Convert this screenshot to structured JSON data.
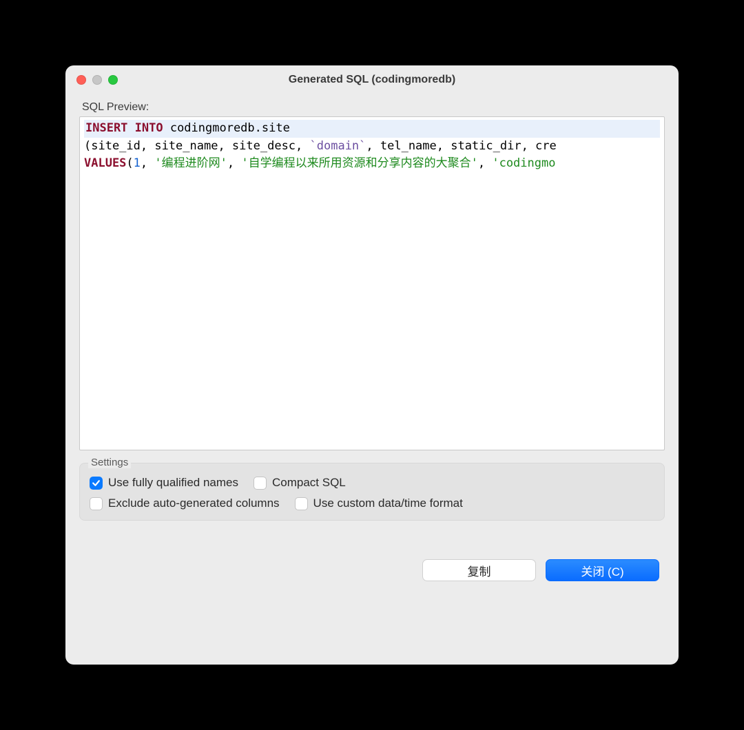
{
  "window": {
    "title": "Generated SQL (codingmoredb)"
  },
  "sections": {
    "preview_label": "SQL Preview:",
    "settings_label": "Settings"
  },
  "sql": {
    "keyword_insert": "INSERT INTO",
    "table": " codingmoredb.site",
    "columns_prefix": "(site_id, site_name, site_desc, ",
    "domain_col": "`domain`",
    "columns_suffix": ", tel_name, static_dir, cre",
    "values_kw": "VALUES",
    "paren": "(",
    "val_num": "1",
    "comma1": ", ",
    "val_str1": "'编程进阶网'",
    "comma2": ", ",
    "val_str2": "'自学编程以来所用资源和分享内容的大聚合'",
    "comma3": ", ",
    "val_str3": "'codingmo"
  },
  "settings": {
    "opt1": {
      "label": "Use fully qualified names",
      "checked": true
    },
    "opt2": {
      "label": "Compact SQL",
      "checked": false
    },
    "opt3": {
      "label": "Exclude auto-generated columns",
      "checked": false
    },
    "opt4": {
      "label": "Use custom data/time format",
      "checked": false
    }
  },
  "buttons": {
    "copy": "复制",
    "close": "关闭 (C)"
  }
}
